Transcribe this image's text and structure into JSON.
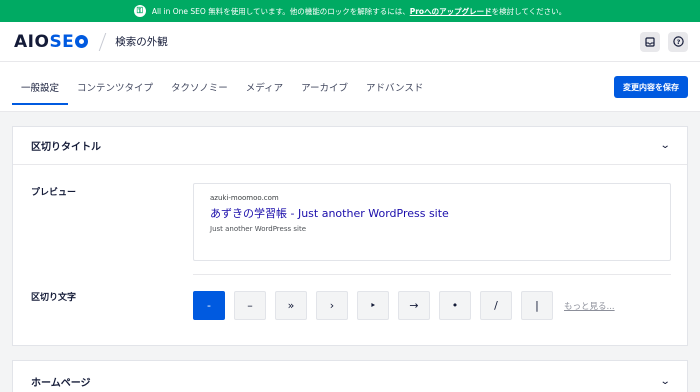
{
  "promo": {
    "text_before": "All in One SEO 無料を使用しています。他の機能のロックを解除するには、",
    "link": "Proへのアップグレード",
    "text_after": "を検討してください。"
  },
  "header": {
    "logo_aio": "AIO",
    "logo_seo": "SE",
    "page_title": "検索の外観"
  },
  "tabs": [
    {
      "label": "一般設定",
      "active": true
    },
    {
      "label": "コンテンツタイプ"
    },
    {
      "label": "タクソノミー"
    },
    {
      "label": "メディア"
    },
    {
      "label": "アーカイブ"
    },
    {
      "label": "アドバンスド"
    }
  ],
  "save_label": "変更内容を保存",
  "separator_card": {
    "title": "区切りタイトル",
    "preview_label": "プレビュー",
    "preview": {
      "url": "azuki-moomoo.com",
      "title": "あずきの学習帳 - Just another WordPress site",
      "description": "Just another WordPress site"
    },
    "separator_label": "区切り文字",
    "separators": [
      "-",
      "–",
      "»",
      "›",
      "‣",
      "→",
      "•",
      "/",
      "|"
    ],
    "selected": "-",
    "more_label": "もっと見る..."
  },
  "homepage_card": {
    "title": "ホームページ"
  },
  "colors": {
    "accent": "#005ae0",
    "promo": "#00aa63"
  },
  "icons": [
    "lock-icon",
    "inbox-icon",
    "help-icon",
    "chevron-down-icon"
  ]
}
